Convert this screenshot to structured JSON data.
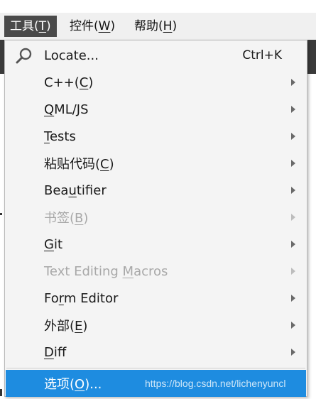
{
  "menubar": {
    "items": [
      {
        "pre": "工具(",
        "key": "T",
        "post": ")"
      },
      {
        "pre": "控件(",
        "key": "W",
        "post": ")"
      },
      {
        "pre": "帮助(",
        "key": "H",
        "post": ")"
      }
    ]
  },
  "menu": {
    "items": [
      {
        "pre": "",
        "key": "",
        "post": "Locate...",
        "shortcut": "Ctrl+K",
        "icon": "search-icon"
      },
      {
        "pre": "C++(",
        "key": "C",
        "post": ")"
      },
      {
        "pre": "",
        "key": "Q",
        "post": "ML/JS"
      },
      {
        "pre": "",
        "key": "T",
        "post": "ests"
      },
      {
        "pre": "粘贴代码(",
        "key": "C",
        "post": ")"
      },
      {
        "pre": "Bea",
        "key": "u",
        "post": "tifier"
      },
      {
        "pre": "书签(",
        "key": "B",
        "post": ")",
        "disabled": true
      },
      {
        "pre": "",
        "key": "G",
        "post": "it"
      },
      {
        "pre": "Text Editing ",
        "key": "M",
        "post": "acros",
        "disabled": true
      },
      {
        "pre": "Fo",
        "key": "r",
        "post": "m Editor"
      },
      {
        "pre": "外部(",
        "key": "E",
        "post": ")"
      },
      {
        "pre": "",
        "key": "D",
        "post": "iff"
      },
      {
        "pre": "选项(",
        "key": "O",
        "post": ")..."
      }
    ]
  },
  "watermark": "https://blog.csdn.net/lichenyuncl",
  "colors": {
    "highlight": "#1e8ce0",
    "disabled_text": "#a8a8a8",
    "active_menubar": "#4a4a4a"
  }
}
